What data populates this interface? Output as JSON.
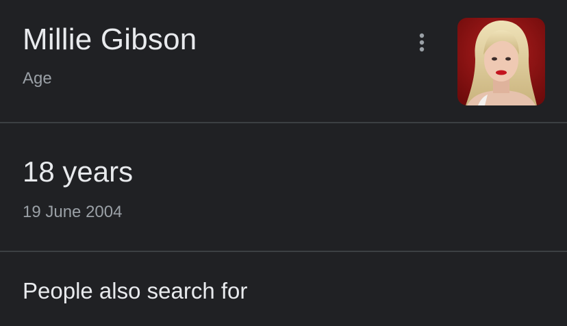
{
  "header": {
    "title": "Millie Gibson",
    "subtitle": "Age",
    "more_icon": "more-vertical-icon",
    "image_alt": "Millie Gibson"
  },
  "answer": {
    "value": "18 years",
    "birth_date": "19 June 2004"
  },
  "section": {
    "heading": "People also search for"
  },
  "colors": {
    "background": "#202124",
    "primary_text": "#e8eaed",
    "secondary_text": "#9aa0a6",
    "divider": "#3c4043"
  }
}
